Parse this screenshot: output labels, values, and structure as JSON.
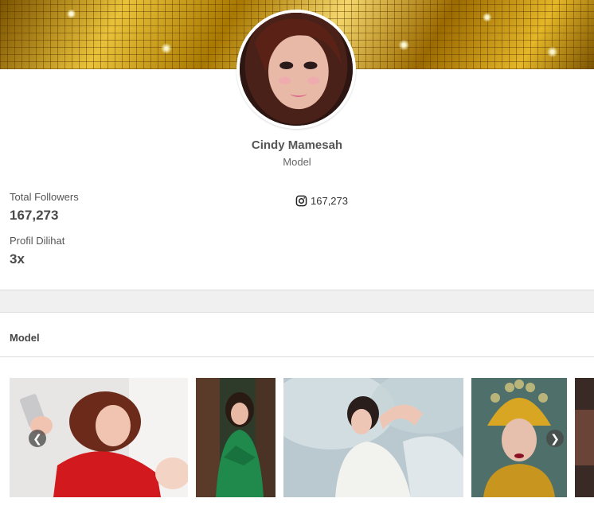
{
  "profile": {
    "name": "Cindy Mamesah",
    "role": "Model"
  },
  "stats": {
    "followers_label": "Total Followers",
    "followers_value": "167,273",
    "views_label": "Profil Dilihat",
    "views_value": "3x"
  },
  "social": {
    "instagram_icon": "instagram-icon",
    "instagram_count": "167,273"
  },
  "section": {
    "title": "Model"
  },
  "gallery": {
    "prev_icon": "arrow-left-icon",
    "next_icon": "arrow-right-icon",
    "prev_glyph": "❮",
    "next_glyph": "❯"
  },
  "colors": {
    "cover_gold": "#c99a0a",
    "divider_gray": "#f0f0f0"
  }
}
